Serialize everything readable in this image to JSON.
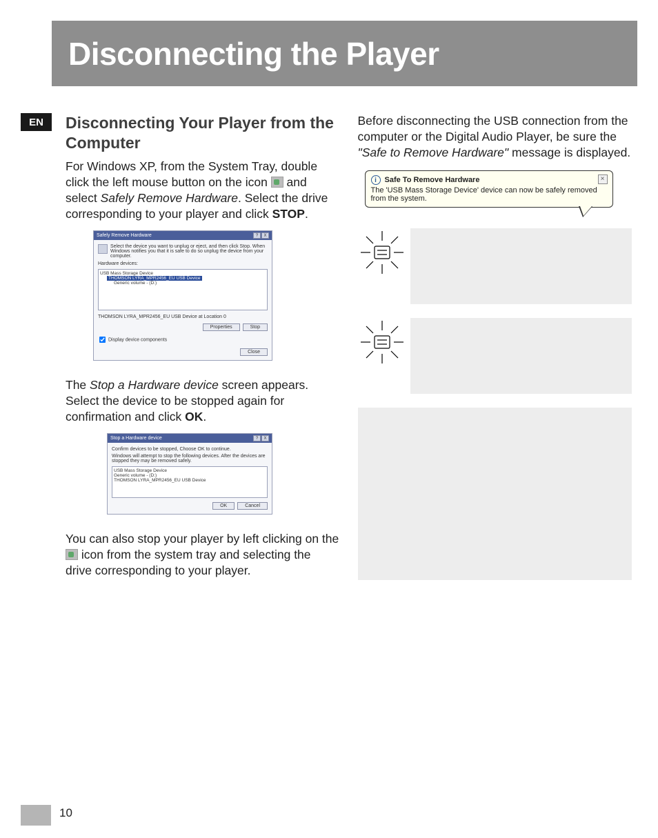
{
  "banner_title": "Disconnecting the Player",
  "lang_code": "EN",
  "left": {
    "heading": "Disconnecting Your Player from the Computer",
    "p1a": "For Windows XP, from the System Tray, double click the left mouse button on the icon ",
    "p1b": " and select ",
    "p1c_italic": "Safely Remove Hardware",
    "p1d": ". Select the drive corresponding to your player and click ",
    "p1e_bold": "STOP",
    "p1f": ".",
    "p2a": "The ",
    "p2b_italic": "Stop a Hardware device",
    "p2c": " screen appears. Select the device to be stopped again for confirmation and click ",
    "p2d_bold": "OK",
    "p2e": ".",
    "p3a": "You can also stop your player by left clicking on the ",
    "p3b": " icon from the system tray and selecting the drive corresponding to your player."
  },
  "right": {
    "p1a": "Before disconnecting the USB connection from the computer or the  Digital Audio Player, be sure the ",
    "p1b_italic_quoted": "\"Safe to Remove Hardware\"",
    "p1c": " message is displayed."
  },
  "dialog_srh": {
    "title": "Safely Remove Hardware",
    "instruction": "Select the device you want to unplug or eject, and then click Stop. When Windows notifies you that it is safe to do so unplug the device from your computer.",
    "label_devices": "Hardware devices:",
    "tree_root": "USB Mass Storage Device",
    "tree_selected": "THOMSON LYRA_MPR2456_EU USB Device",
    "tree_child": "Generic volume - (D:)",
    "location_text": "THOMSON LYRA_MPR2456_EU USB Device at Location 0",
    "btn_properties": "Properties",
    "btn_stop": "Stop",
    "chk_display": "Display device components",
    "btn_close": "Close"
  },
  "dialog_stop": {
    "title": "Stop a Hardware device",
    "line1": "Confirm devices to be stopped, Choose OK to continue.",
    "line2": "Windows will attempt to stop the following devices. After the devices are stopped they may be removed safely.",
    "item1": "USB Mass Storage Device",
    "item2": "Generic volume - (D:)",
    "item3": "THOMSON LYRA_MPR2456_EU USB Device",
    "btn_ok": "OK",
    "btn_cancel": "Cancel"
  },
  "balloon": {
    "title": "Safe To Remove Hardware",
    "body": "The 'USB Mass Storage Device' device can now be safely removed from the system."
  },
  "page_number": "10"
}
